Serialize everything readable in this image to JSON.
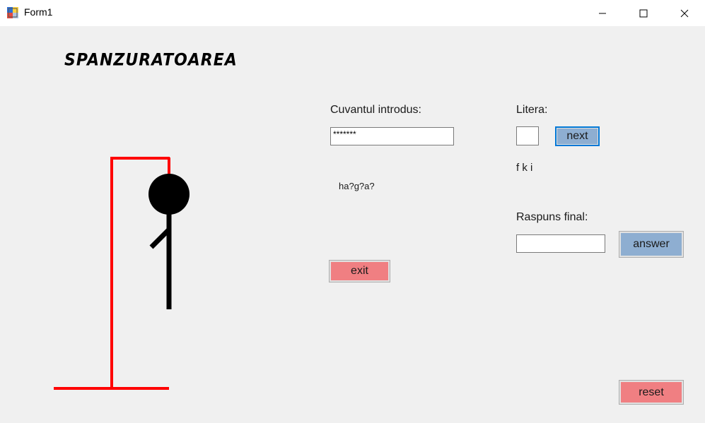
{
  "window": {
    "title": "Form1",
    "icons": {
      "app": "form-app-icon",
      "minimize": "minimize-icon",
      "maximize": "maximize-icon",
      "close": "close-icon"
    }
  },
  "game": {
    "title": "SPANZURATOAREA",
    "word_label": "Cuvantul introdus:",
    "word_value": "*******",
    "masked_word": "ha?g?a?",
    "letter_label": "Litera:",
    "letter_value": "",
    "next_label": "next",
    "used_letters": "f k i",
    "final_label": "Raspuns final:",
    "final_value": "",
    "answer_label": "answer",
    "exit_label": "exit",
    "reset_label": "reset"
  },
  "colors": {
    "gallows": "#ff0000",
    "figure": "#000000",
    "blue_button": "#8eaed1",
    "red_button": "#f07f82"
  }
}
